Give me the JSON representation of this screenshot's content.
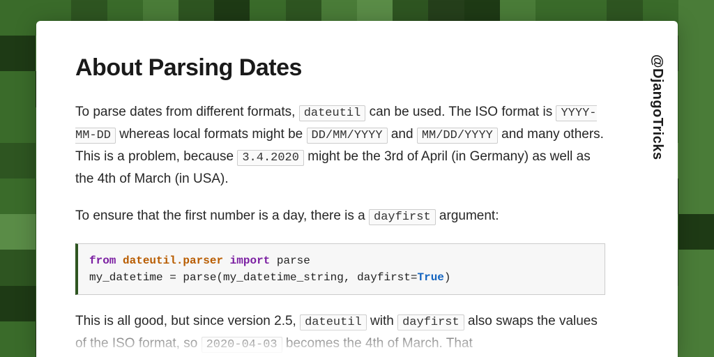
{
  "handle": "@DjangoTricks",
  "title": "About Parsing Dates",
  "p1": {
    "t1": "To parse dates from different formats, ",
    "c1": "dateutil",
    "t2": " can be used. The ISO format is ",
    "c2": "YYYY-MM-DD",
    "t3": " whereas local formats might be ",
    "c3": "DD/MM/YYYY",
    "t4": " and ",
    "c4": "MM/DD/YYYY",
    "t5": " and many others. This is a problem, because ",
    "c5": "3.4.2020",
    "t6": " might be the 3rd of April (in Germany) as well as the 4th of March (in USA)."
  },
  "p2": {
    "t1": "To ensure that the first number is a day, there is a ",
    "c1": "dayfirst",
    "t2": " argument:"
  },
  "code": {
    "kw_from": "from",
    "mod": "dateutil.parser",
    "kw_import": "import",
    "fn": " parse",
    "line2_a": "my_datetime = parse(my_datetime_string, dayfirst=",
    "bool": "True",
    "line2_b": ")"
  },
  "p3": {
    "t1": "This is all good, but since version 2.5, ",
    "c1": "dateutil",
    "t2": " with ",
    "c2": "dayfirst",
    "t3": " also swaps the values of the ISO format, so ",
    "c3": "2020-04-03",
    "t4": " becomes the 4th of March. That"
  }
}
